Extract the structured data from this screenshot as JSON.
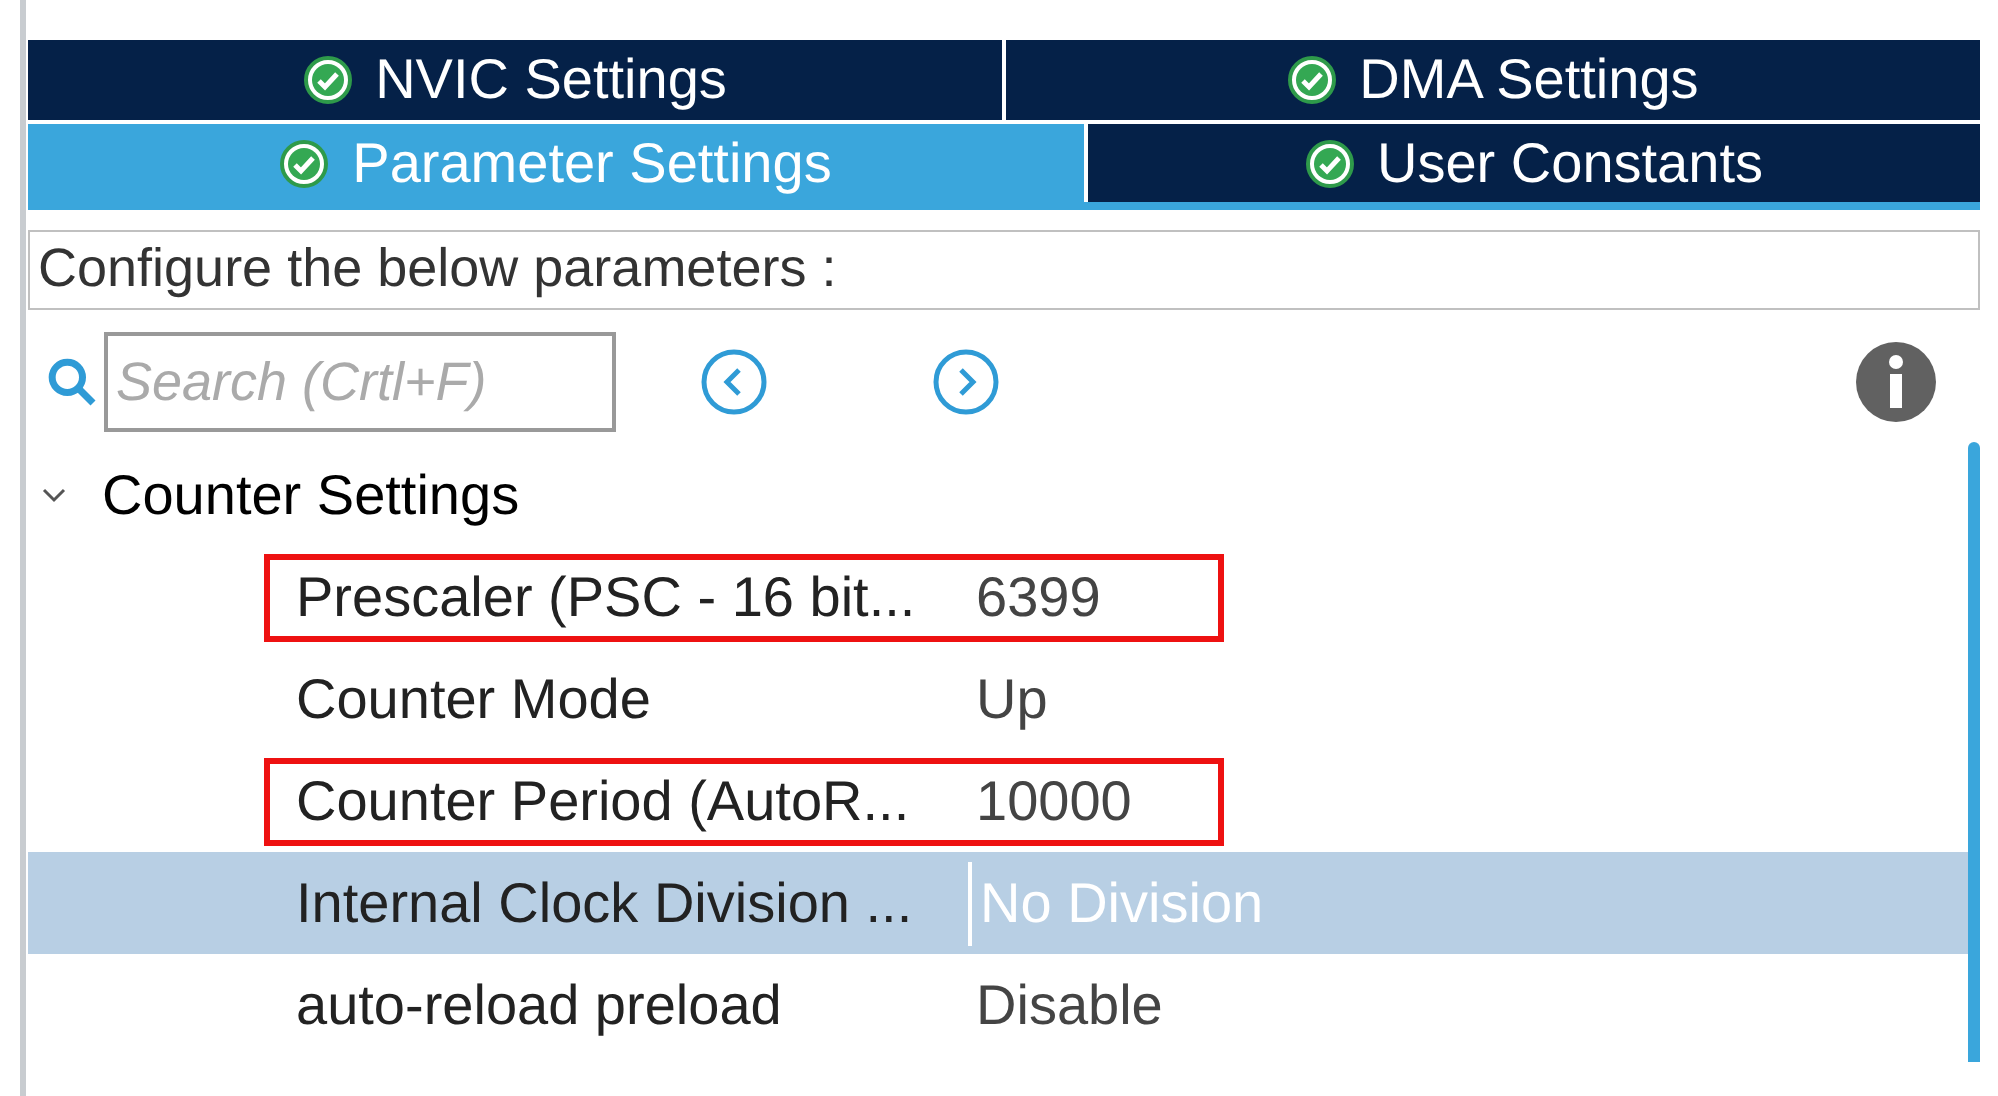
{
  "tab_rows": [
    [
      {
        "label": "NVIC Settings",
        "selected": false
      },
      {
        "label": "DMA Settings",
        "selected": false
      }
    ],
    [
      {
        "label": "Parameter Settings",
        "selected": true
      },
      {
        "label": "User Constants",
        "selected": false
      }
    ]
  ],
  "description": "Configure the below parameters :",
  "search": {
    "placeholder": "Search (Crtl+F)"
  },
  "group": {
    "title": "Counter Settings",
    "expanded": true,
    "rows": [
      {
        "name": "Prescaler (PSC - 16 bit...",
        "value": "6399",
        "selected": false,
        "outlined": true
      },
      {
        "name": "Counter Mode",
        "value": "Up",
        "selected": false,
        "outlined": false
      },
      {
        "name": "Counter Period (AutoR...",
        "value": "10000",
        "selected": false,
        "outlined": true
      },
      {
        "name": "Internal Clock Division ...",
        "value": "No Division",
        "selected": true,
        "outlined": false
      },
      {
        "name": "auto-reload preload",
        "value": "Disable",
        "selected": false,
        "outlined": false
      }
    ]
  }
}
